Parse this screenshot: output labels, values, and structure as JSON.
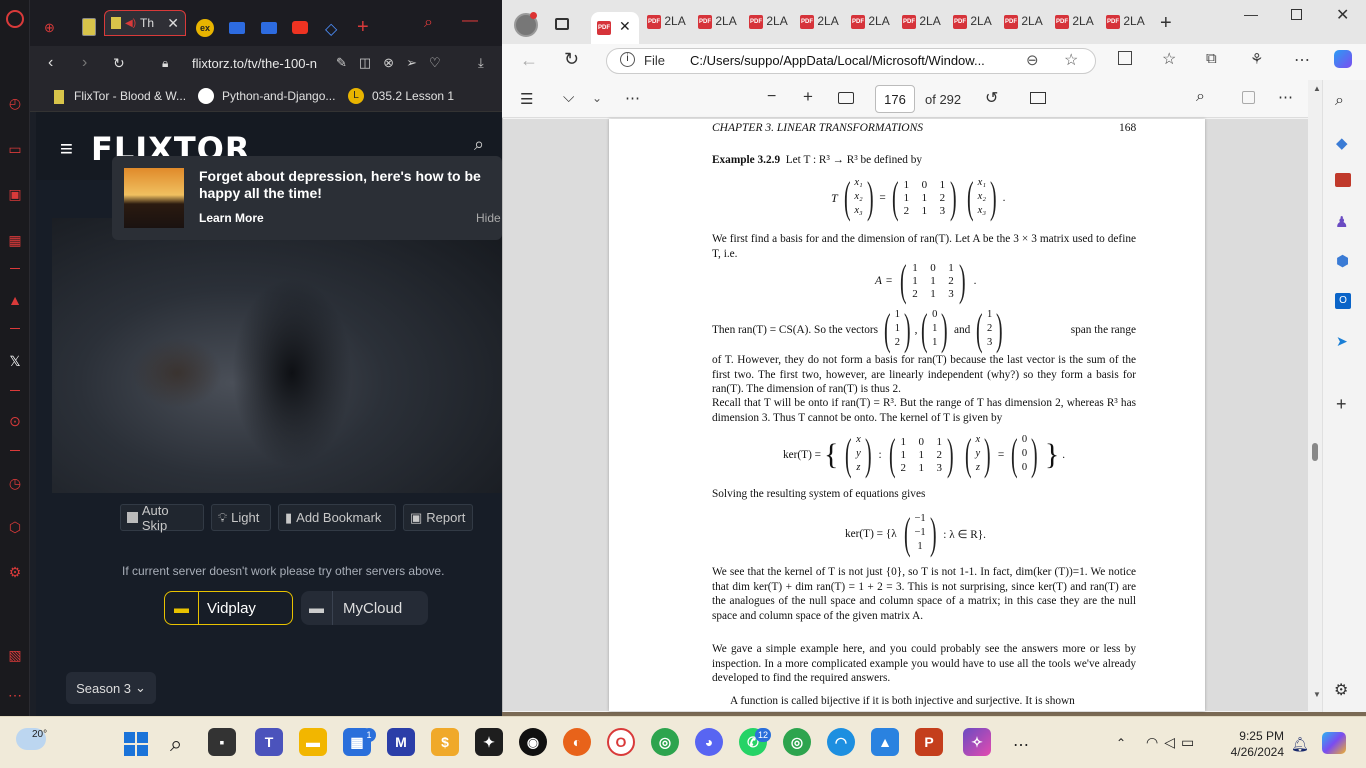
{
  "opera": {
    "tabs": [
      {
        "label": "Th",
        "active": true
      },
      {
        "label": "ex"
      }
    ],
    "url": "flixtorz.to/tv/the-100-n",
    "bookmarks": [
      {
        "label": "FlixTor - Blood & W..."
      },
      {
        "label": "Python-and-Django..."
      },
      {
        "label": "035.2 Lesson 1"
      }
    ]
  },
  "flixtor": {
    "logo": "FLIXTOR",
    "notification": {
      "title": "Forget about depression, here's how to be happy all the time!",
      "learn_more": "Learn More",
      "hide": "Hide"
    },
    "controls": [
      "Auto Skip",
      "Light",
      "Add Bookmark",
      "Report"
    ],
    "server_hint": "If current server doesn't work please try other servers above.",
    "servers": [
      "Vidplay",
      "MyCloud"
    ],
    "season": "Season 3"
  },
  "edge": {
    "tabs": [
      "2LA",
      "2LA",
      "2LA",
      "2LA",
      "2LA",
      "2LA",
      "2LA",
      "2LA",
      "2LA",
      "2LA"
    ],
    "file_label": "File",
    "path": "C:/Users/suppo/AppData/Local/Microsoft/Window...",
    "page_number": "176",
    "page_total": "of 292"
  },
  "pdf": {
    "chapter": "CHAPTER 3.  LINEAR TRANSFORMATIONS",
    "page": "168",
    "example_label": "Example 3.2.9",
    "example_text": "Let T : R³ → R³ be defined by",
    "p1": "We first find a basis for and the dimension of ran(T). Let A be the 3 × 3 matrix used to define T, i.e.",
    "then_text": "Then ran(T) = CS(A). So the vectors",
    "and_text": "and",
    "span_text": "span the range",
    "p2": "of T. However, they do not form a basis for ran(T) because the last vector is the sum of the first two. The first two, however, are linearly independent (why?) so they form a basis for ran(T). The dimension of ran(T) is thus 2.",
    "p3": "Recall that T will be onto if ran(T) = R³. But the range of T has dimension 2, whereas R³ has dimension 3. Thus T cannot be onto. The kernel of T is given by",
    "ker_label": "ker(T) =",
    "solving": "Solving the resulting system of equations gives",
    "ker2_label": "ker(T) = {λ",
    "ker2_tail": ": λ ∈ R}.",
    "p4": "We see that the kernel of T is not just {0}, so T is not 1-1. In fact, dim(ker (T))=1. We notice that dim ker(T) + dim ran(T) = 1 + 2 = 3. This is not surprising, since ker(T) and ran(T) are the analogues of the null space and column space of a matrix; in this case they are the null space and column space of the given matrix A.",
    "p5": "We gave a simple example here, and you could probably see the answers more or less by inspection. In a more complicated example you would have to use all the tools we've already developed to find the required answers.",
    "p6": "A function is called bijective if it is both injective and surjective. It is shown",
    "matrix": [
      [
        "1",
        "0",
        "1"
      ],
      [
        "1",
        "1",
        "2"
      ],
      [
        "2",
        "1",
        "3"
      ]
    ],
    "x_vec": [
      "x₁",
      "x₂",
      "x₃"
    ],
    "v1": [
      "1",
      "1",
      "2"
    ],
    "v2": [
      "0",
      "1",
      "1"
    ],
    "v3": [
      "1",
      "2",
      "3"
    ],
    "xyz": [
      "x",
      "y",
      "z"
    ],
    "zero": [
      "0",
      "0",
      "0"
    ],
    "lambda_vec": [
      "−1",
      "−1",
      "1"
    ]
  },
  "taskbar": {
    "weather": "20°",
    "time": "9:25 PM",
    "date": "4/26/2024",
    "teams_badge": "1",
    "whatsapp_badge": "12"
  }
}
